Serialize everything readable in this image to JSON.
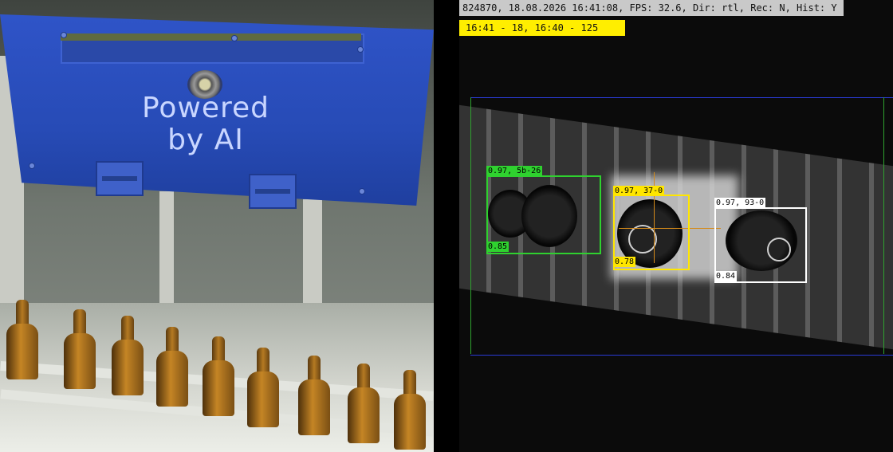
{
  "left_scene": {
    "plate_text_line1": "Powered",
    "plate_text_line2": "by AI"
  },
  "camera_view": {
    "status_bar": "824870, 18.08.2026 16:41:08, FPS: 32.6, Dir: rtl, Rec: N, Hist: Y",
    "counter_bar": "16:41 - 18, 16:40 - 125",
    "detections": [
      {
        "top_label": "0.97, 5b-26",
        "bottom_label": "0.85",
        "color": "#2fd12f"
      },
      {
        "top_label": "0.97, 37-0",
        "bottom_label": "0.78",
        "color": "#ffe600"
      },
      {
        "top_label": "0.97, 93-0",
        "bottom_label": "0.84",
        "color": "#ffffff"
      }
    ],
    "colors": {
      "roi_border": "#2a3bd6",
      "roi_side": "#2fa32f",
      "crosshair": "#d48a1a"
    }
  }
}
